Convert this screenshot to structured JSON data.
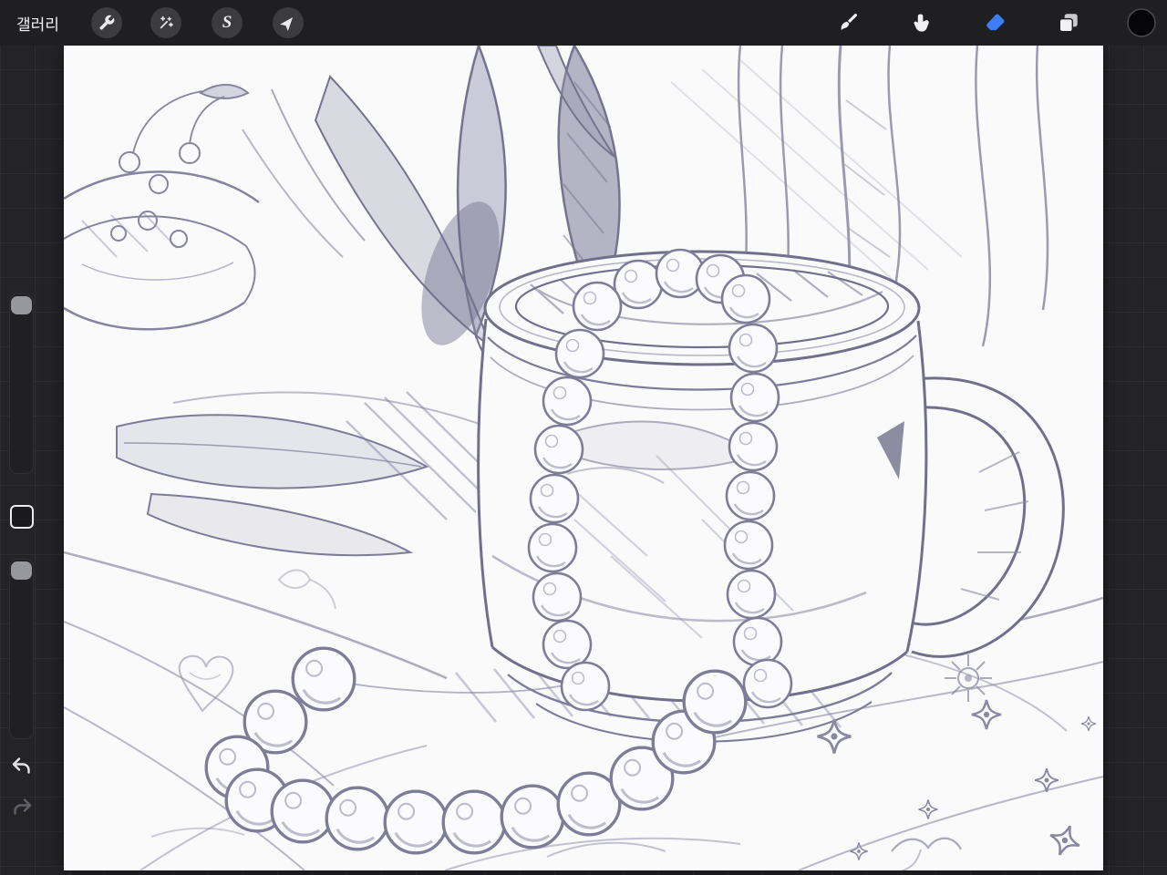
{
  "topbar": {
    "gallery_label": "갤러리",
    "left_tools": [
      {
        "name": "actions",
        "icon": "wrench-icon"
      },
      {
        "name": "adjustments",
        "icon": "magic-wand-icon"
      },
      {
        "name": "selection",
        "icon": "selection-s-icon",
        "glyph": "S"
      },
      {
        "name": "transform",
        "icon": "transform-arrow-icon"
      }
    ],
    "right_tools": [
      {
        "name": "paint",
        "icon": "paintbrush-icon",
        "active": false
      },
      {
        "name": "smudge",
        "icon": "smudge-finger-icon",
        "active": false
      },
      {
        "name": "erase",
        "icon": "eraser-icon",
        "active": true
      },
      {
        "name": "layers",
        "icon": "layers-icon",
        "active": false
      },
      {
        "name": "color",
        "icon": "color-disc-icon",
        "current_color": "#000000"
      }
    ],
    "active_tool_tint": "#3d7df8"
  },
  "sidebar": {
    "brush_size_slider": {
      "name": "brush-size",
      "handle_position": "top"
    },
    "modify_button": {
      "name": "modify"
    },
    "opacity_slider": {
      "name": "opacity",
      "handle_position": "top"
    },
    "undo_button": {
      "name": "undo"
    },
    "redo_button": {
      "name": "redo"
    }
  },
  "canvas": {
    "paper_color": "#fafafb",
    "pencil_color": "#7c7c98",
    "artwork_description": "Graphite still-life sketch: a mug with a pearl necklace draped over it onto a cloth, hanging foliage and trunks above, a plate with berries at top-left, large leaves mid-left, and small star and flower doodles at lower-right"
  }
}
